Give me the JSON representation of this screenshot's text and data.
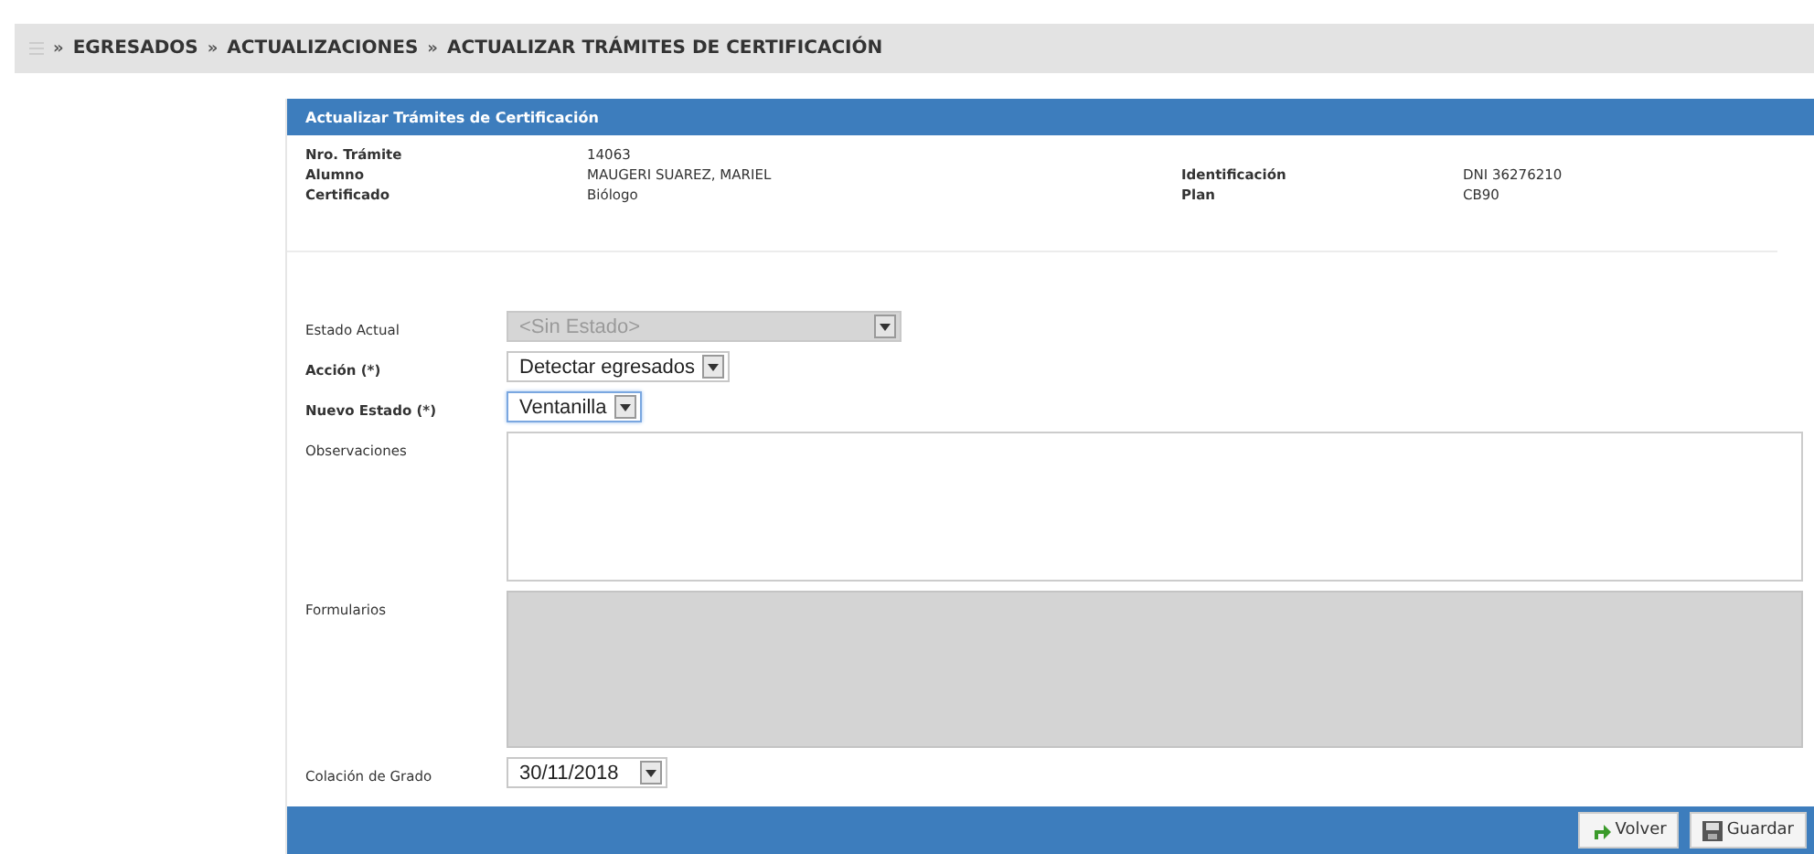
{
  "breadcrumb_separator": "»",
  "breadcrumb": [
    "EGRESADOS",
    "ACTUALIZACIONES",
    "ACTUALIZAR TRÁMITES DE CERTIFICACIÓN"
  ],
  "panel": {
    "title": "Actualizar Trámites de Certificación"
  },
  "info": [
    {
      "label": "Nro. Trámite",
      "value": "14063"
    },
    {
      "label": "Alumno",
      "value": "MAUGERI SUAREZ, MARIEL"
    },
    {
      "label": "Identificación",
      "value": "DNI 36276210"
    },
    {
      "label": "Certificado",
      "value": "Biólogo"
    },
    {
      "label": "Plan",
      "value": "CB90"
    }
  ],
  "form": [
    {
      "kind": "select",
      "label": "Estado Actual",
      "bold": false,
      "value": "<Sin Estado>",
      "disabled": true,
      "focused": false
    },
    {
      "kind": "select",
      "label": "Acción (*)",
      "bold": true,
      "value": "Detectar egresados",
      "disabled": false,
      "focused": false
    },
    {
      "kind": "select",
      "label": "Nuevo Estado (*)",
      "bold": true,
      "value": "Ventanilla",
      "disabled": false,
      "focused": true
    },
    {
      "kind": "textarea",
      "label": "Observaciones",
      "bold": false
    },
    {
      "kind": "readonly",
      "label": "Formularios",
      "bold": false
    },
    {
      "kind": "date",
      "label": "Colación de Grado",
      "bold": false,
      "value": "30/11/2018"
    }
  ],
  "buttons": [
    {
      "kind": "back",
      "label": "Volver"
    },
    {
      "kind": "save",
      "label": "Guardar"
    }
  ]
}
